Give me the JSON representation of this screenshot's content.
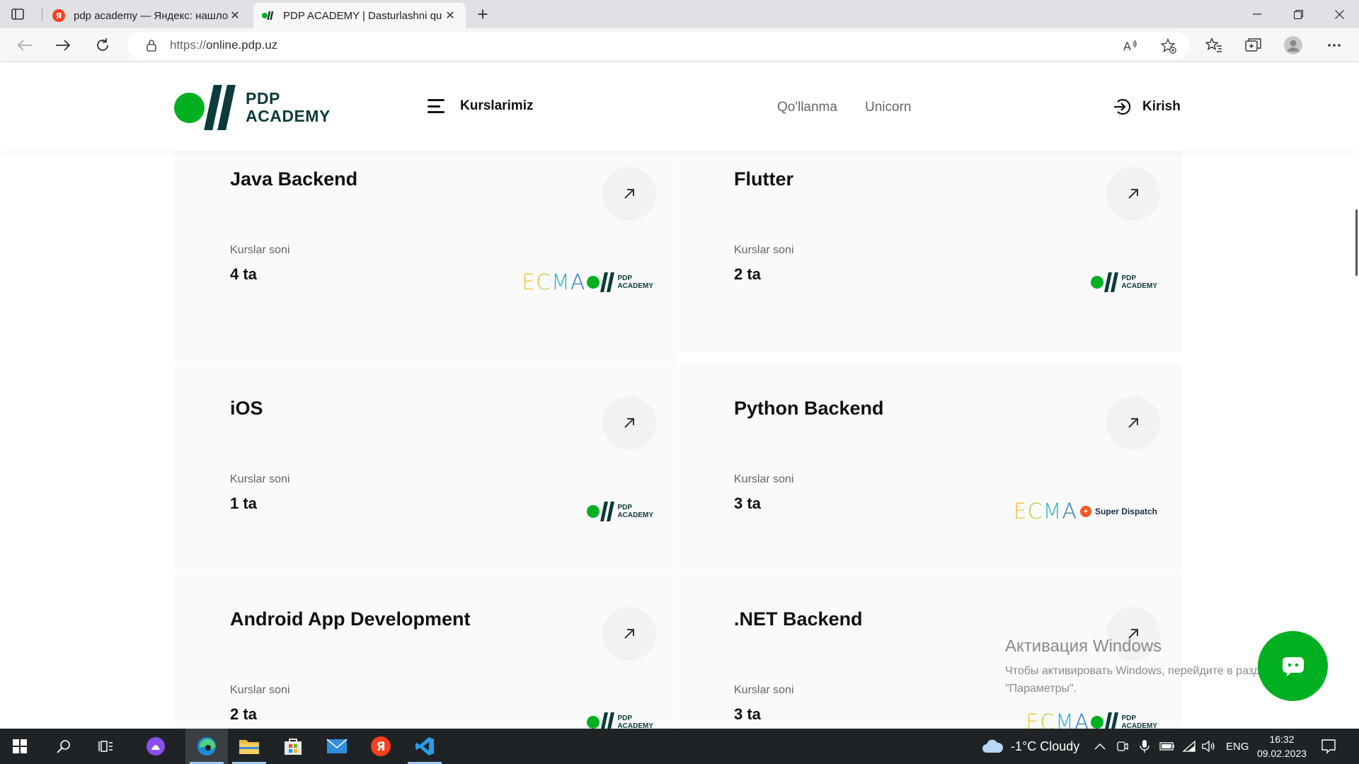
{
  "browser": {
    "tabs": [
      {
        "title": "pdp academy — Яндекс: нашлось",
        "favicon": "yandex-icon",
        "active": false
      },
      {
        "title": "PDP ACADEMY | Dasturlashni qu",
        "favicon": "pdp-favicon",
        "active": true
      }
    ],
    "url_protocol": "https://",
    "url_host": "online.pdp.uz"
  },
  "header": {
    "logo_line1": "PDP",
    "logo_line2": "ACADEMY",
    "menu_label": "Kurslarimiz",
    "nav": [
      "Qo'llanma",
      "Unicorn"
    ],
    "login_label": "Kirish",
    "brand_green": "#00b021",
    "brand_dark": "#0d3b3b"
  },
  "courses": [
    {
      "title": "Java Backend",
      "count_label": "Kurslar soni",
      "count": "4 ta",
      "partners": [
        "ECMA",
        "PDP ACADEMY"
      ]
    },
    {
      "title": "Flutter",
      "count_label": "Kurslar soni",
      "count": "2 ta",
      "partners": [
        "PDP ACADEMY"
      ]
    },
    {
      "title": "iOS",
      "count_label": "Kurslar soni",
      "count": "1 ta",
      "partners": [
        "PDP ACADEMY"
      ]
    },
    {
      "title": "Python Backend",
      "count_label": "Kurslar soni",
      "count": "3 ta",
      "partners": [
        "ECMA",
        "Super Dispatch"
      ]
    },
    {
      "title": "Android App Development",
      "count_label": "Kurslar soni",
      "count": "2 ta",
      "partners": [
        "PDP ACADEMY"
      ]
    },
    {
      "title": ".NET Backend",
      "count_label": "Kurslar soni",
      "count": "3 ta",
      "partners": [
        "ECMA",
        "PDP ACADEMY"
      ]
    }
  ],
  "partner_text": {
    "ecma": [
      "E",
      "C",
      "M",
      "A"
    ],
    "pdp_line1": "PDP",
    "pdp_line2": "ACADEMY",
    "super_dispatch": "Super Dispatch"
  },
  "watermark": {
    "title": "Активация Windows",
    "body": "Чтобы активировать Windows, перейдите в раздел \"Параметры\"."
  },
  "taskbar": {
    "weather": "-1°C  Cloudy",
    "language": "ENG",
    "time": "16:32",
    "date": "09.02.2023"
  }
}
